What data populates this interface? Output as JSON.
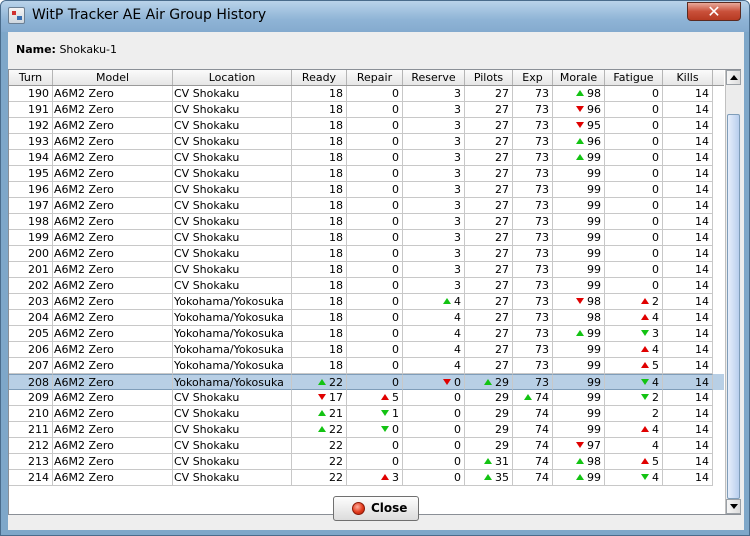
{
  "window": {
    "title": "WitP Tracker AE Air Group History",
    "close_glyph": "✕"
  },
  "name_label": "Name:",
  "name_value": "Shokaku-1",
  "columns": [
    "Turn",
    "Model",
    "Location",
    "Ready",
    "Repair",
    "Reserve",
    "Pilots",
    "Exp",
    "Morale",
    "Fatigue",
    "Kills"
  ],
  "rows": [
    {
      "turn": "190",
      "model": "A6M2 Zero",
      "location": "CV Shokaku",
      "ready": "18",
      "repair": "0",
      "reserve": "3",
      "pilots": "27",
      "exp": "73",
      "morale": "98",
      "morale_ind": "up",
      "fatigue": "0",
      "kills": "14"
    },
    {
      "turn": "191",
      "model": "A6M2 Zero",
      "location": "CV Shokaku",
      "ready": "18",
      "repair": "0",
      "reserve": "3",
      "pilots": "27",
      "exp": "73",
      "morale": "96",
      "morale_ind": "down",
      "fatigue": "0",
      "kills": "14"
    },
    {
      "turn": "192",
      "model": "A6M2 Zero",
      "location": "CV Shokaku",
      "ready": "18",
      "repair": "0",
      "reserve": "3",
      "pilots": "27",
      "exp": "73",
      "morale": "95",
      "morale_ind": "down",
      "fatigue": "0",
      "kills": "14"
    },
    {
      "turn": "193",
      "model": "A6M2 Zero",
      "location": "CV Shokaku",
      "ready": "18",
      "repair": "0",
      "reserve": "3",
      "pilots": "27",
      "exp": "73",
      "morale": "96",
      "morale_ind": "up",
      "fatigue": "0",
      "kills": "14"
    },
    {
      "turn": "194",
      "model": "A6M2 Zero",
      "location": "CV Shokaku",
      "ready": "18",
      "repair": "0",
      "reserve": "3",
      "pilots": "27",
      "exp": "73",
      "morale": "99",
      "morale_ind": "up",
      "fatigue": "0",
      "kills": "14"
    },
    {
      "turn": "195",
      "model": "A6M2 Zero",
      "location": "CV Shokaku",
      "ready": "18",
      "repair": "0",
      "reserve": "3",
      "pilots": "27",
      "exp": "73",
      "morale": "99",
      "fatigue": "0",
      "kills": "14"
    },
    {
      "turn": "196",
      "model": "A6M2 Zero",
      "location": "CV Shokaku",
      "ready": "18",
      "repair": "0",
      "reserve": "3",
      "pilots": "27",
      "exp": "73",
      "morale": "99",
      "fatigue": "0",
      "kills": "14"
    },
    {
      "turn": "197",
      "model": "A6M2 Zero",
      "location": "CV Shokaku",
      "ready": "18",
      "repair": "0",
      "reserve": "3",
      "pilots": "27",
      "exp": "73",
      "morale": "99",
      "fatigue": "0",
      "kills": "14"
    },
    {
      "turn": "198",
      "model": "A6M2 Zero",
      "location": "CV Shokaku",
      "ready": "18",
      "repair": "0",
      "reserve": "3",
      "pilots": "27",
      "exp": "73",
      "morale": "99",
      "fatigue": "0",
      "kills": "14"
    },
    {
      "turn": "199",
      "model": "A6M2 Zero",
      "location": "CV Shokaku",
      "ready": "18",
      "repair": "0",
      "reserve": "3",
      "pilots": "27",
      "exp": "73",
      "morale": "99",
      "fatigue": "0",
      "kills": "14"
    },
    {
      "turn": "200",
      "model": "A6M2 Zero",
      "location": "CV Shokaku",
      "ready": "18",
      "repair": "0",
      "reserve": "3",
      "pilots": "27",
      "exp": "73",
      "morale": "99",
      "fatigue": "0",
      "kills": "14"
    },
    {
      "turn": "201",
      "model": "A6M2 Zero",
      "location": "CV Shokaku",
      "ready": "18",
      "repair": "0",
      "reserve": "3",
      "pilots": "27",
      "exp": "73",
      "morale": "99",
      "fatigue": "0",
      "kills": "14"
    },
    {
      "turn": "202",
      "model": "A6M2 Zero",
      "location": "CV Shokaku",
      "ready": "18",
      "repair": "0",
      "reserve": "3",
      "pilots": "27",
      "exp": "73",
      "morale": "99",
      "fatigue": "0",
      "kills": "14"
    },
    {
      "turn": "203",
      "model": "A6M2 Zero",
      "location": "Yokohama/Yokosuka",
      "ready": "18",
      "repair": "0",
      "reserve": "4",
      "reserve_ind": "up",
      "pilots": "27",
      "exp": "73",
      "morale": "98",
      "morale_ind": "down",
      "fatigue": "2",
      "fatigue_ind": "redup",
      "kills": "14"
    },
    {
      "turn": "204",
      "model": "A6M2 Zero",
      "location": "Yokohama/Yokosuka",
      "ready": "18",
      "repair": "0",
      "reserve": "4",
      "pilots": "27",
      "exp": "73",
      "morale": "98",
      "fatigue": "4",
      "fatigue_ind": "redup",
      "kills": "14"
    },
    {
      "turn": "205",
      "model": "A6M2 Zero",
      "location": "Yokohama/Yokosuka",
      "ready": "18",
      "repair": "0",
      "reserve": "4",
      "pilots": "27",
      "exp": "73",
      "morale": "99",
      "morale_ind": "up",
      "fatigue": "3",
      "fatigue_ind": "greendown",
      "kills": "14"
    },
    {
      "turn": "206",
      "model": "A6M2 Zero",
      "location": "Yokohama/Yokosuka",
      "ready": "18",
      "repair": "0",
      "reserve": "4",
      "pilots": "27",
      "exp": "73",
      "morale": "99",
      "fatigue": "4",
      "fatigue_ind": "redup",
      "kills": "14"
    },
    {
      "turn": "207",
      "model": "A6M2 Zero",
      "location": "Yokohama/Yokosuka",
      "ready": "18",
      "repair": "0",
      "reserve": "4",
      "pilots": "27",
      "exp": "73",
      "morale": "99",
      "fatigue": "5",
      "fatigue_ind": "redup",
      "kills": "14"
    },
    {
      "turn": "208",
      "model": "A6M2 Zero",
      "location": "Yokohama/Yokosuka",
      "ready": "22",
      "ready_ind": "up",
      "repair": "0",
      "reserve": "0",
      "reserve_ind": "down",
      "pilots": "29",
      "pilots_ind": "up",
      "exp": "73",
      "morale": "99",
      "fatigue": "4",
      "fatigue_ind": "greendown",
      "kills": "14",
      "selected": true
    },
    {
      "turn": "209",
      "model": "A6M2 Zero",
      "location": "CV Shokaku",
      "ready": "17",
      "ready_ind": "down",
      "repair": "5",
      "repair_ind": "redup",
      "reserve": "0",
      "pilots": "29",
      "exp": "74",
      "exp_ind": "up",
      "morale": "99",
      "fatigue": "2",
      "fatigue_ind": "greendown",
      "kills": "14"
    },
    {
      "turn": "210",
      "model": "A6M2 Zero",
      "location": "CV Shokaku",
      "ready": "21",
      "ready_ind": "up",
      "repair": "1",
      "repair_ind": "greendown",
      "reserve": "0",
      "pilots": "29",
      "exp": "74",
      "morale": "99",
      "fatigue": "2",
      "kills": "14"
    },
    {
      "turn": "211",
      "model": "A6M2 Zero",
      "location": "CV Shokaku",
      "ready": "22",
      "ready_ind": "up",
      "repair": "0",
      "repair_ind": "greendown",
      "reserve": "0",
      "pilots": "29",
      "exp": "74",
      "morale": "99",
      "fatigue": "4",
      "fatigue_ind": "redup",
      "kills": "14"
    },
    {
      "turn": "212",
      "model": "A6M2 Zero",
      "location": "CV Shokaku",
      "ready": "22",
      "repair": "0",
      "reserve": "0",
      "pilots": "29",
      "exp": "74",
      "morale": "97",
      "morale_ind": "down",
      "fatigue": "4",
      "kills": "14"
    },
    {
      "turn": "213",
      "model": "A6M2 Zero",
      "location": "CV Shokaku",
      "ready": "22",
      "repair": "0",
      "reserve": "0",
      "pilots": "31",
      "pilots_ind": "up",
      "exp": "74",
      "morale": "98",
      "morale_ind": "up",
      "fatigue": "5",
      "fatigue_ind": "redup",
      "kills": "14"
    },
    {
      "turn": "214",
      "model": "A6M2 Zero",
      "location": "CV Shokaku",
      "ready": "22",
      "repair": "3",
      "repair_ind": "redup",
      "reserve": "0",
      "pilots": "35",
      "pilots_ind": "up",
      "exp": "74",
      "morale": "99",
      "morale_ind": "up",
      "fatigue": "4",
      "fatigue_ind": "greendown",
      "kills": "14"
    }
  ],
  "close_button": {
    "label": "Close"
  },
  "scroll": {
    "position_fraction": 0.985,
    "visible_fraction": 0.93
  }
}
